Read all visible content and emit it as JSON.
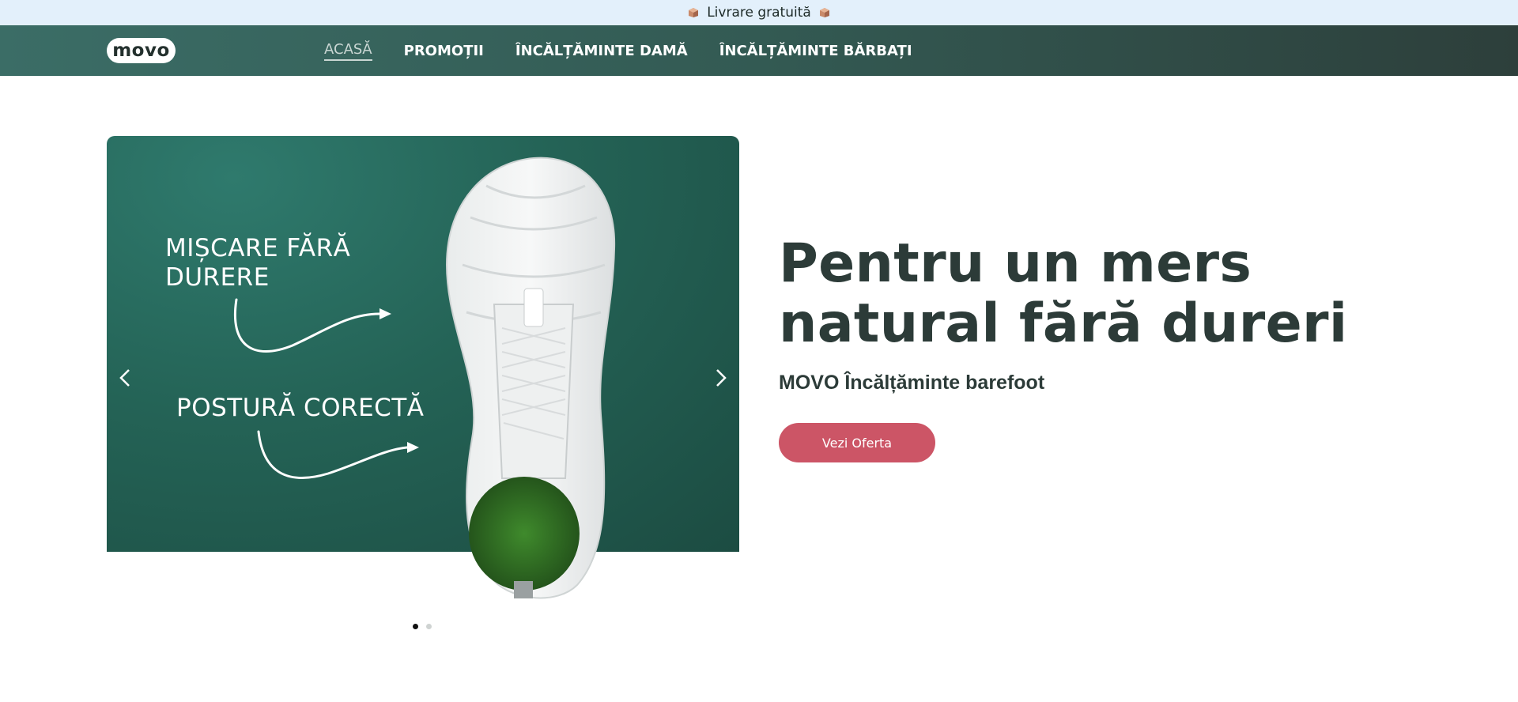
{
  "announcement": {
    "text": "Livrare gratuită",
    "icon": "package-icon"
  },
  "header": {
    "logo_text": "movo",
    "nav": [
      {
        "label": "ACASĂ",
        "active": true
      },
      {
        "label": "PROMOȚII",
        "active": false
      },
      {
        "label": "ÎNCĂLȚĂMINTE DAMĂ",
        "active": false
      },
      {
        "label": "ÎNCĂLȚĂMINTE BĂRBAȚI",
        "active": false
      }
    ]
  },
  "slider": {
    "slides": [
      {
        "line1": "MIȘCARE FĂRĂ DURERE",
        "line2": "POSTURĂ CORECTĂ"
      }
    ],
    "prev_icon": "chevron-left-icon",
    "next_icon": "chevron-right-icon",
    "dot_count": 2,
    "active_dot": 0
  },
  "hero": {
    "title": "Pentru un mers natural fără dureri",
    "subtitle": "MOVO Încălțăminte barefoot",
    "cta_label": "Vezi Oferta"
  },
  "colors": {
    "header_start": "#3b6d66",
    "header_end": "#2d3f3b",
    "slider_bg": "#246356",
    "cta": "#cc5566",
    "heading": "#2c3b38",
    "announce_bg": "#e3f0fb"
  }
}
